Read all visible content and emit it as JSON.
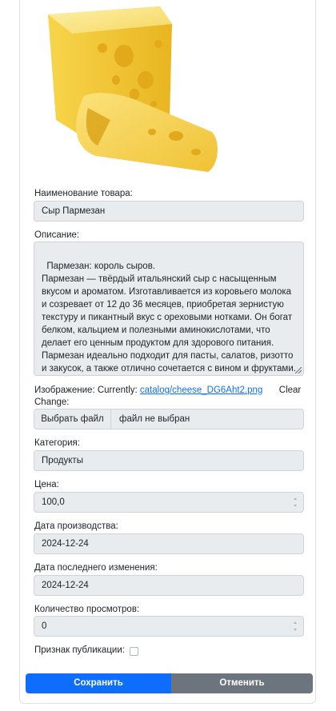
{
  "product": {
    "image_alt": "cheese",
    "name_label": "Наименование товара:",
    "name_value": "Сыр Пармезан",
    "description_label": "Описание:",
    "description_value": "Пармезан: король сыров.\nПармезан — твёрдый итальянский сыр с насыщенным вкусом и ароматом. Изготавливается из коровьего молока и созревает от 12 до 36 месяцев, приобретая зернистую текстуру и пикантный вкус с ореховыми нотками. Он богат белком, кальцием и полезными аминокислотами, что делает его ценным продуктом для здорового питания. Пармезан идеально подходит для пасты, салатов, ризотто и закусок, а также отлично сочетается с вином и фруктами. Этот сыр не только придаёт блюдам изысканный вкус, но и подчеркивает их текстуру и аромат",
    "image_label": "Изображение:",
    "currently_label": "Currently:",
    "current_image_link": "catalog/cheese_DG6Aht2.png",
    "clear_label": "Clear",
    "change_label": "Change:",
    "choose_file_label": "Выбрать файл",
    "no_file_text": "файл не выбран",
    "category_label": "Категория:",
    "category_value": "Продукты",
    "price_label": "Цена:",
    "price_value": "100,0",
    "production_date_label": "Дата производства:",
    "production_date_value": "2024-12-24",
    "modified_date_label": "Дата последнего изменения:",
    "modified_date_value": "2024-12-24",
    "views_label": "Количество просмотров:",
    "views_value": "0",
    "published_label": "Признак публикации:",
    "published_checked": false
  },
  "actions": {
    "save_label": "Сохранить",
    "cancel_label": "Отменить"
  },
  "colors": {
    "primary": "#0d6efd",
    "secondary": "#6c757d",
    "field_bg": "#e9ecef",
    "link": "#0d6efd"
  }
}
